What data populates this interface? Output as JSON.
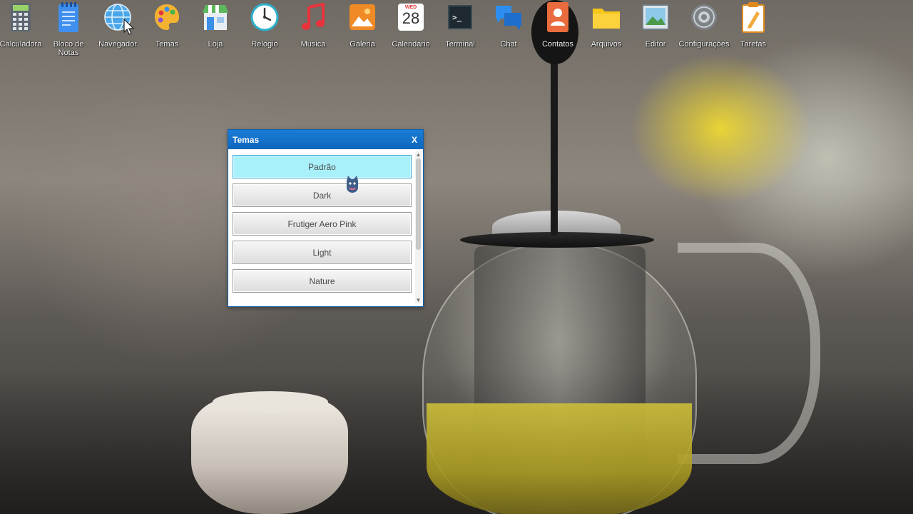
{
  "desktop": {
    "icons": [
      {
        "id": "calculadora",
        "label": "Calculadora",
        "icon": "calculator-icon"
      },
      {
        "id": "bloco-de-notas",
        "label": "Bloco de Notas",
        "icon": "notepad-icon"
      },
      {
        "id": "navegador",
        "label": "Navegador",
        "icon": "globe-icon"
      },
      {
        "id": "temas",
        "label": "Temas",
        "icon": "palette-icon"
      },
      {
        "id": "loja",
        "label": "Loja",
        "icon": "store-icon"
      },
      {
        "id": "relogio",
        "label": "Relogio",
        "icon": "clock-icon"
      },
      {
        "id": "musica",
        "label": "Musica",
        "icon": "music-note-icon"
      },
      {
        "id": "galeria",
        "label": "Galeria",
        "icon": "gallery-icon"
      },
      {
        "id": "calendario",
        "label": "Calendario",
        "icon": "calendar-icon",
        "day_label": "WED",
        "day_number": "28"
      },
      {
        "id": "terminal",
        "label": "Terminal",
        "icon": "terminal-icon",
        "prompt": ">_"
      },
      {
        "id": "chat",
        "label": "Chat",
        "icon": "chat-bubbles-icon"
      },
      {
        "id": "contatos",
        "label": "Contatos",
        "icon": "contacts-icon"
      },
      {
        "id": "arquivos",
        "label": "Arquivos",
        "icon": "folder-icon"
      },
      {
        "id": "editor",
        "label": "Editor",
        "icon": "image-editor-icon"
      },
      {
        "id": "configuracoes",
        "label": "Configurações",
        "icon": "gear-icon"
      },
      {
        "id": "tarefas",
        "label": "Tarefas",
        "icon": "task-clipboard-icon"
      }
    ]
  },
  "window": {
    "title": "Temas",
    "close_label": "X",
    "themes": [
      {
        "label": "Padrão",
        "selected": true
      },
      {
        "label": "Dark",
        "selected": false
      },
      {
        "label": "Frutiger Aero Pink",
        "selected": false
      },
      {
        "label": "Light",
        "selected": false
      },
      {
        "label": "Nature",
        "selected": false
      }
    ],
    "scroll_up": "▲",
    "scroll_down": "▼"
  },
  "colors": {
    "titlebar": "#1a7dd6",
    "selected_theme": "#a8f1fb",
    "button_bg": "#e8e8e8"
  }
}
